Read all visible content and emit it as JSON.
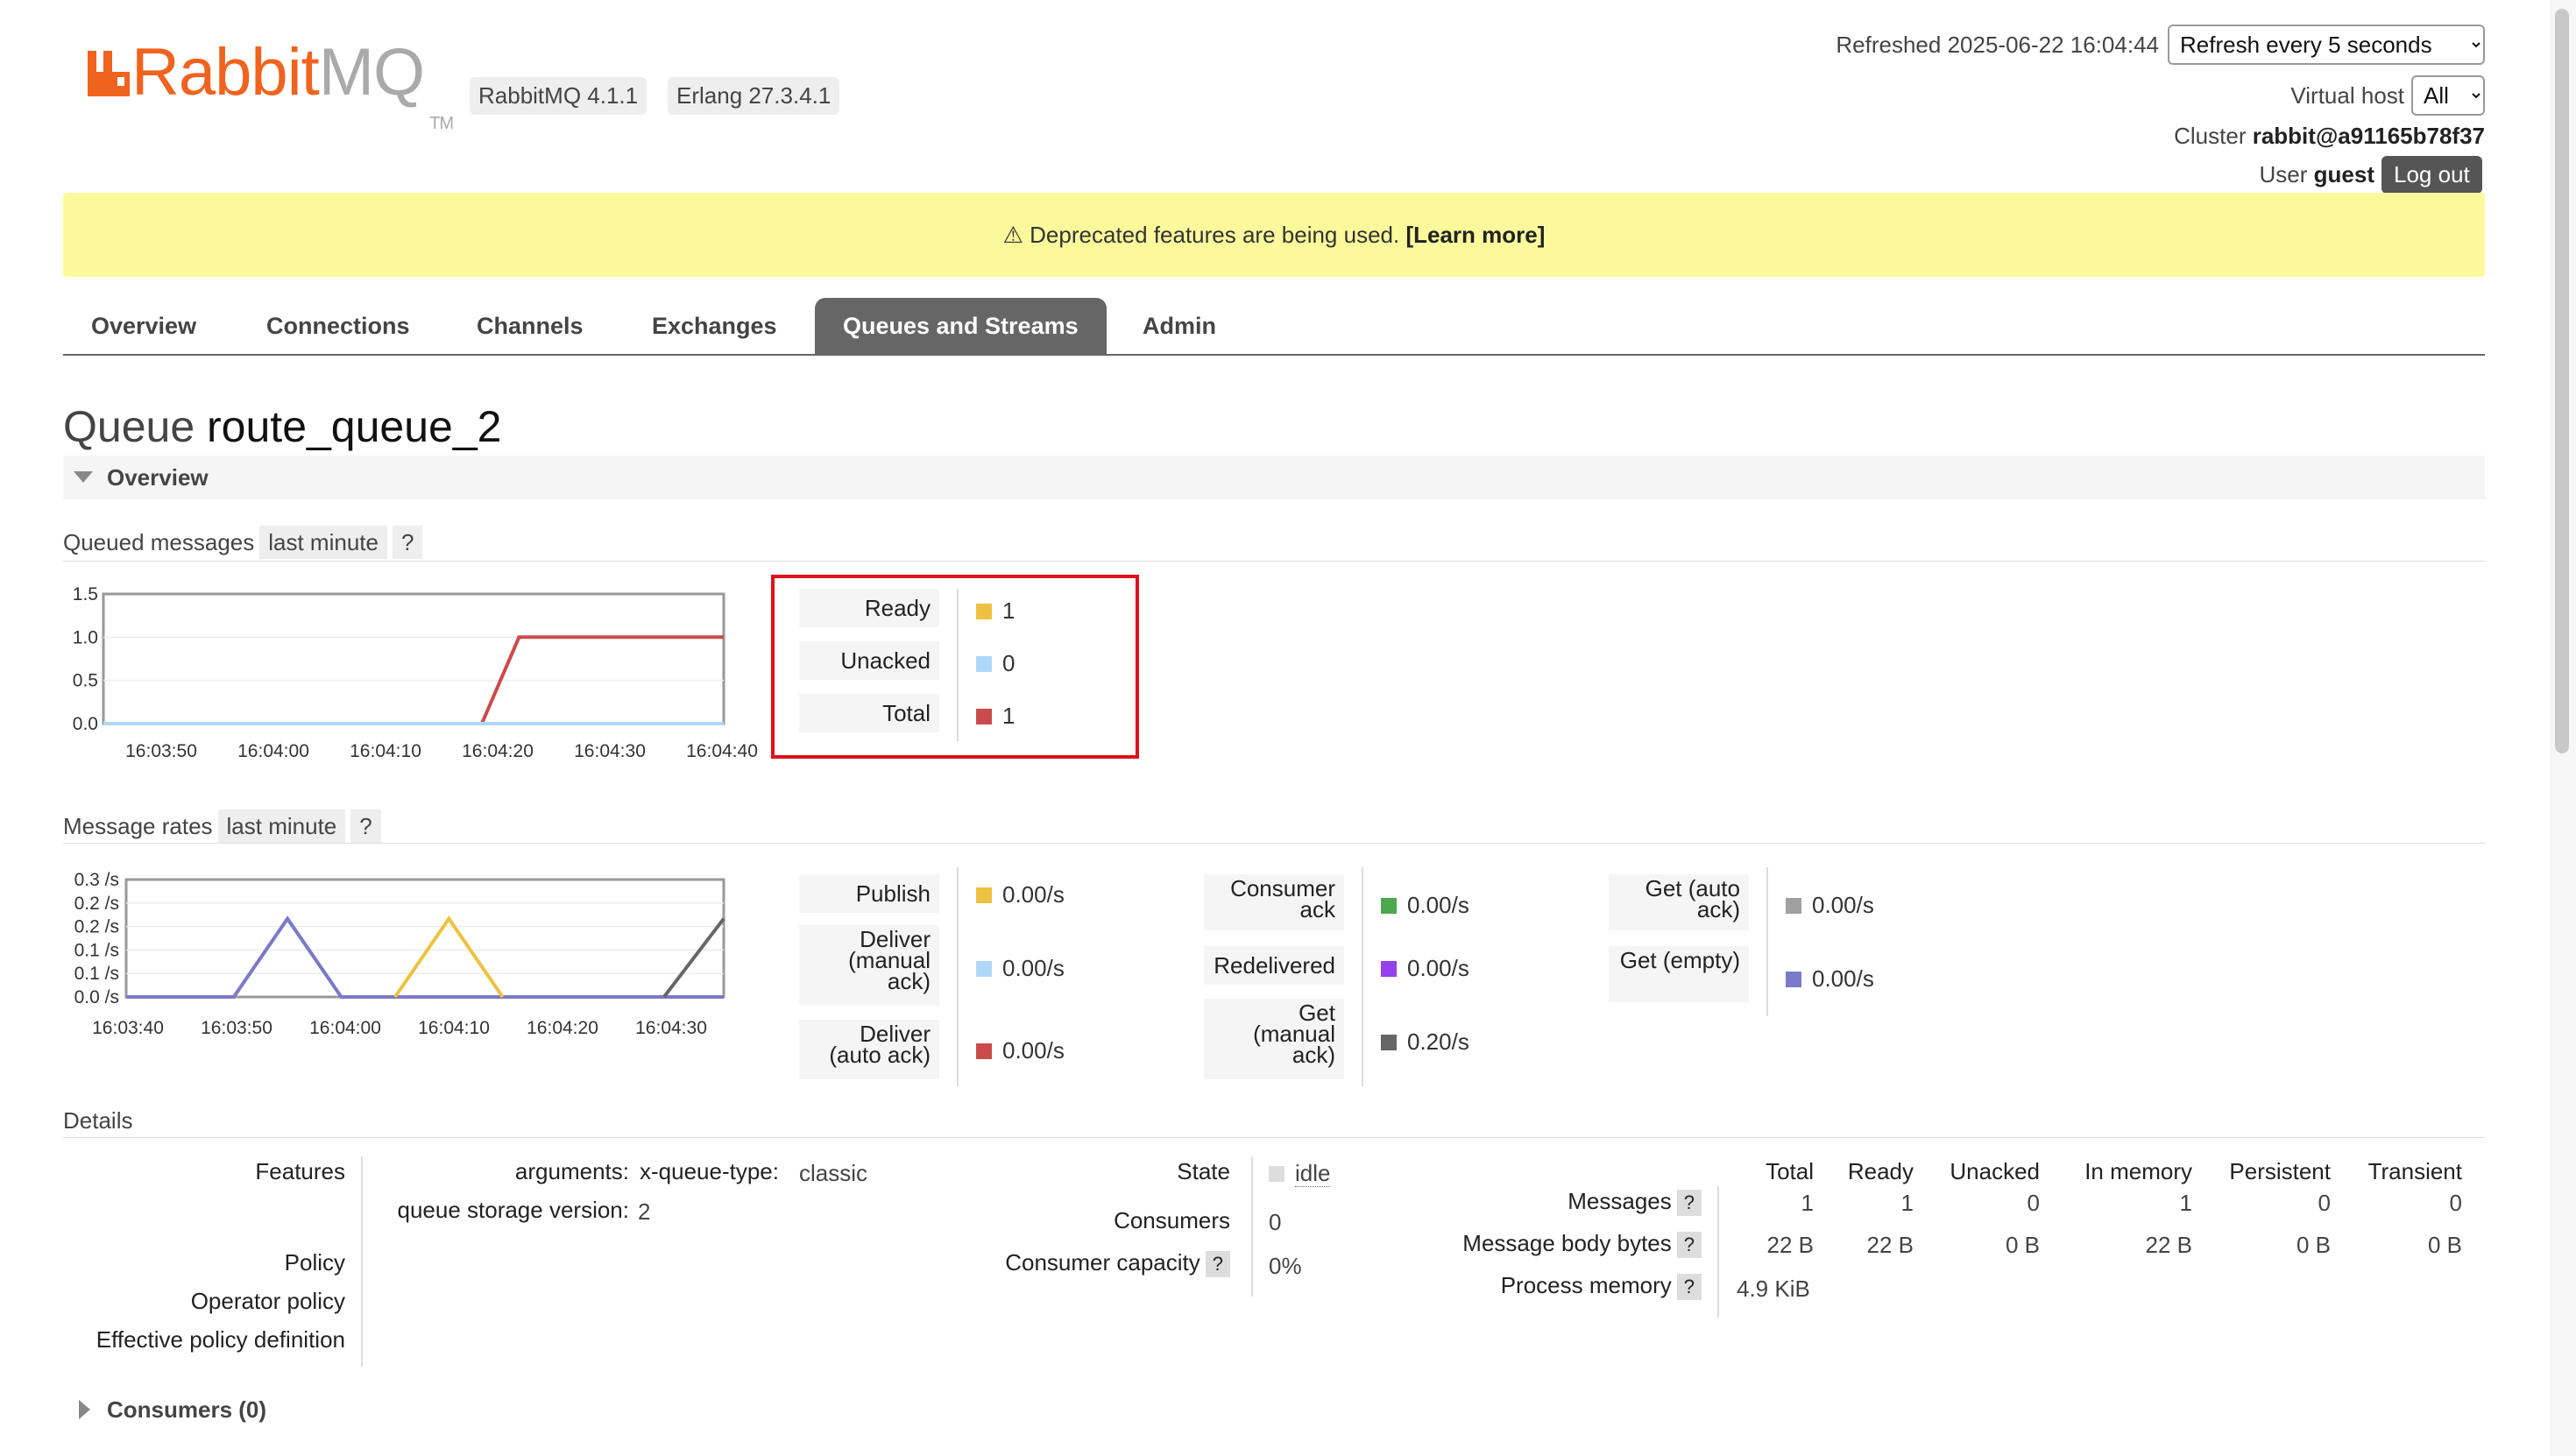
{
  "brand": {
    "name_part1": "Rabbit",
    "name_part2": "MQ",
    "tm": "TM",
    "color": "#f0631e"
  },
  "versions": {
    "rabbitmq": "RabbitMQ 4.1.1",
    "erlang": "Erlang 27.3.4.1"
  },
  "header": {
    "refreshed_label": "Refreshed 2025-06-22 16:04:44",
    "refresh_option": "Refresh every 5 seconds",
    "vhost_label": "Virtual host",
    "vhost_value": "All",
    "cluster_label": "Cluster",
    "cluster_value": "rabbit@a91165b78f37",
    "user_label": "User",
    "user_value": "guest",
    "logout": "Log out"
  },
  "banner": {
    "text": "⚠ Deprecated features are being used.",
    "link": "[Learn more]",
    "color": "#fbf99b"
  },
  "tabs": [
    "Overview",
    "Connections",
    "Channels",
    "Exchanges",
    "Queues and Streams",
    "Admin"
  ],
  "active_tab": "Queues and Streams",
  "page": {
    "title_prefix": "Queue",
    "queue_name": "route_queue_2",
    "section": "Overview"
  },
  "queued_messages": {
    "label": "Queued messages",
    "range": "last minute",
    "help": "?",
    "stats": [
      {
        "label": "Ready",
        "value": "1",
        "color": "#edc240"
      },
      {
        "label": "Unacked",
        "value": "0",
        "color": "#afd8f8"
      },
      {
        "label": "Total",
        "value": "1",
        "color": "#cb4b4b"
      }
    ],
    "chart_data": {
      "type": "line",
      "x": [
        "16:03:50",
        "16:04:00",
        "16:04:10",
        "16:04:20",
        "16:04:30",
        "16:04:40"
      ],
      "yticks": [
        "1.5",
        "1.0",
        "0.5",
        "0.0"
      ],
      "ylim": [
        0,
        1.5
      ],
      "series": [
        {
          "name": "Total",
          "color": "#cb4b4b",
          "points": [
            [
              0,
              0
            ],
            [
              0.61,
              0
            ],
            [
              0.67,
              1
            ],
            [
              1,
              1
            ]
          ]
        },
        {
          "name": "Unacked",
          "color": "#afd8f8",
          "points": [
            [
              0,
              0
            ],
            [
              1,
              0
            ]
          ]
        }
      ]
    }
  },
  "message_rates": {
    "label": "Message rates",
    "range": "last minute",
    "help": "?",
    "col1": [
      {
        "label": "Publish",
        "value": "0.00/s",
        "color": "#edc240"
      },
      {
        "label": "Deliver (manual ack)",
        "value": "0.00/s",
        "color": "#afd8f8"
      },
      {
        "label": "Deliver (auto ack)",
        "value": "0.00/s",
        "color": "#cb4b4b"
      }
    ],
    "col2": [
      {
        "label": "Consumer ack",
        "value": "0.00/s",
        "color": "#4da74d"
      },
      {
        "label": "Redelivered",
        "value": "0.00/s",
        "color": "#9440ed"
      },
      {
        "label": "Get (manual ack)",
        "value": "0.20/s",
        "color": "#666666"
      }
    ],
    "col3": [
      {
        "label": "Get (auto ack)",
        "value": "0.00/s",
        "color": "#a0a0a0"
      },
      {
        "label": "Get (empty)",
        "value": "0.00/s",
        "color": "#7c79c9"
      }
    ],
    "chart_data": {
      "type": "line",
      "x": [
        "16:03:40",
        "16:03:50",
        "16:04:00",
        "16:04:10",
        "16:04:20",
        "16:04:30"
      ],
      "yticks": [
        "0.3 /s",
        "0.2 /s",
        "0.2 /s",
        "0.1 /s",
        "0.1 /s",
        "0.0 /s"
      ],
      "ylim": [
        0,
        0.3
      ],
      "series": [
        {
          "name": "Get (empty)",
          "color": "#7c79c9",
          "points": [
            [
              0,
              0
            ],
            [
              0.18,
              0
            ],
            [
              0.27,
              0.2
            ],
            [
              0.36,
              0
            ],
            [
              1,
              0
            ]
          ]
        },
        {
          "name": "Publish",
          "color": "#edc240",
          "points": [
            [
              0.45,
              0
            ],
            [
              0.54,
              0.2
            ],
            [
              0.63,
              0
            ]
          ]
        },
        {
          "name": "Get (manual ack)",
          "color": "#666666",
          "points": [
            [
              0.9,
              0
            ],
            [
              1,
              0.2
            ]
          ]
        }
      ]
    }
  },
  "details": {
    "label": "Details",
    "features_label": "Features",
    "arguments_label": "arguments:",
    "arguments_key": "x-queue-type:",
    "arguments_value": "classic",
    "storage_label": "queue storage version:",
    "storage_value": "2",
    "policy_label": "Policy",
    "operator_policy_label": "Operator policy",
    "effective_policy_label": "Effective policy definition",
    "state_label": "State",
    "state_value": "idle",
    "consumers_label": "Consumers",
    "consumers_value": "0",
    "capacity_label": "Consumer capacity",
    "capacity_value": "0%",
    "help": "?",
    "table": {
      "columns": [
        "Total",
        "Ready",
        "Unacked",
        "In memory",
        "Persistent",
        "Transient"
      ],
      "rows": [
        {
          "label": "Messages",
          "values": [
            "1",
            "1",
            "0",
            "1",
            "0",
            "0"
          ]
        },
        {
          "label": "Message body bytes",
          "values": [
            "22 B",
            "22 B",
            "0 B",
            "22 B",
            "0 B",
            "0 B"
          ]
        },
        {
          "label": "Process memory",
          "values": [
            "4.9 KiB"
          ]
        }
      ]
    }
  },
  "consumers_section": "Consumers (0)"
}
